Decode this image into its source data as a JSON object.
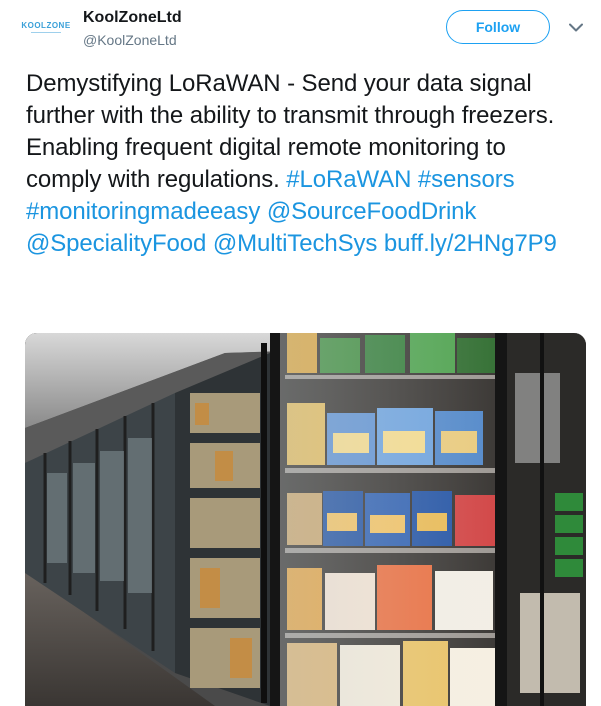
{
  "author": {
    "name": "KoolZoneLtd",
    "handle": "@KoolZoneLtd",
    "avatar_text": "KOOLZONE"
  },
  "actions": {
    "follow_label": "Follow"
  },
  "tweet": {
    "text_plain": "Demystifying LoRaWAN - Send your data signal further with the ability to transmit through freezers. Enabling frequent digital remote monitoring to comply with regulations. ",
    "links": [
      {
        "text": "#LoRaWAN"
      },
      {
        "text": "#sensors"
      },
      {
        "text": "#monitoringmadeeasy"
      },
      {
        "text": "@SourceFoodDrink"
      },
      {
        "text": "@SpecialityFood"
      },
      {
        "text": "@MultiTechSys"
      },
      {
        "text": "buff.ly/2HNg7P9"
      }
    ]
  },
  "colors": {
    "link": "#1b95e0",
    "follow": "#1da1f2",
    "text": "#14171a",
    "secondary": "#657786"
  },
  "icons": {
    "caret": "chevron-down-icon"
  }
}
